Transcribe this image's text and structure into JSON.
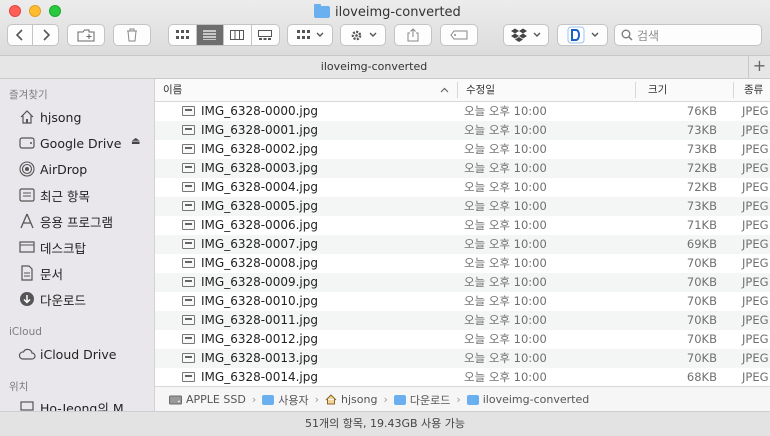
{
  "window": {
    "title": "iloveimg-converted"
  },
  "toolbar": {
    "back_icon": "chevron-left-icon",
    "forward_icon": "chevron-right-icon",
    "search_placeholder": "검색"
  },
  "tab": {
    "title": "iloveimg-converted",
    "plus": "+"
  },
  "sidebar": {
    "favorites_header": "즐겨찾기",
    "favorites": [
      {
        "label": "hjsong",
        "icon": "home-icon"
      },
      {
        "label": "Google Drive",
        "icon": "drive-icon"
      },
      {
        "label": "AirDrop",
        "icon": "airdrop-icon"
      },
      {
        "label": "최근 항목",
        "icon": "recents-icon"
      },
      {
        "label": "응용 프로그램",
        "icon": "applications-icon"
      },
      {
        "label": "데스크탑",
        "icon": "desktop-icon"
      },
      {
        "label": "문서",
        "icon": "document-icon"
      },
      {
        "label": "다운로드",
        "icon": "download-icon"
      }
    ],
    "icloud_header": "iCloud",
    "icloud_drive": "iCloud Drive",
    "locations_header": "위치",
    "location_item": "Ho-Jeong의 M",
    "eject": "⏏"
  },
  "columns": {
    "name": "이름",
    "date": "수정일",
    "size": "크기",
    "kind": "종류"
  },
  "files": [
    {
      "name": "IMG_6328-0000.jpg",
      "date": "오늘 오후 10:00",
      "size": "76KB",
      "kind": "JPEG"
    },
    {
      "name": "IMG_6328-0001.jpg",
      "date": "오늘 오후 10:00",
      "size": "73KB",
      "kind": "JPEG"
    },
    {
      "name": "IMG_6328-0002.jpg",
      "date": "오늘 오후 10:00",
      "size": "73KB",
      "kind": "JPEG"
    },
    {
      "name": "IMG_6328-0003.jpg",
      "date": "오늘 오후 10:00",
      "size": "72KB",
      "kind": "JPEG"
    },
    {
      "name": "IMG_6328-0004.jpg",
      "date": "오늘 오후 10:00",
      "size": "72KB",
      "kind": "JPEG"
    },
    {
      "name": "IMG_6328-0005.jpg",
      "date": "오늘 오후 10:00",
      "size": "73KB",
      "kind": "JPEG"
    },
    {
      "name": "IMG_6328-0006.jpg",
      "date": "오늘 오후 10:00",
      "size": "71KB",
      "kind": "JPEG"
    },
    {
      "name": "IMG_6328-0007.jpg",
      "date": "오늘 오후 10:00",
      "size": "69KB",
      "kind": "JPEG"
    },
    {
      "name": "IMG_6328-0008.jpg",
      "date": "오늘 오후 10:00",
      "size": "70KB",
      "kind": "JPEG"
    },
    {
      "name": "IMG_6328-0009.jpg",
      "date": "오늘 오후 10:00",
      "size": "70KB",
      "kind": "JPEG"
    },
    {
      "name": "IMG_6328-0010.jpg",
      "date": "오늘 오후 10:00",
      "size": "70KB",
      "kind": "JPEG"
    },
    {
      "name": "IMG_6328-0011.jpg",
      "date": "오늘 오후 10:00",
      "size": "70KB",
      "kind": "JPEG"
    },
    {
      "name": "IMG_6328-0012.jpg",
      "date": "오늘 오후 10:00",
      "size": "70KB",
      "kind": "JPEG"
    },
    {
      "name": "IMG_6328-0013.jpg",
      "date": "오늘 오후 10:00",
      "size": "70KB",
      "kind": "JPEG"
    },
    {
      "name": "IMG_6328-0014.jpg",
      "date": "오늘 오후 10:00",
      "size": "68KB",
      "kind": "JPEG"
    }
  ],
  "pathbar": {
    "items": [
      "APPLE SSD",
      "사용자",
      "hjsong",
      "다운로드",
      "iloveimg-converted"
    ],
    "separator": "›"
  },
  "status": {
    "text": "51개의 항목, 19.43GB 사용 가능"
  },
  "colors": {
    "close": "#ff5f57",
    "minimize": "#febc2e",
    "maximize": "#28c840",
    "folder": "#6ab0ef"
  }
}
